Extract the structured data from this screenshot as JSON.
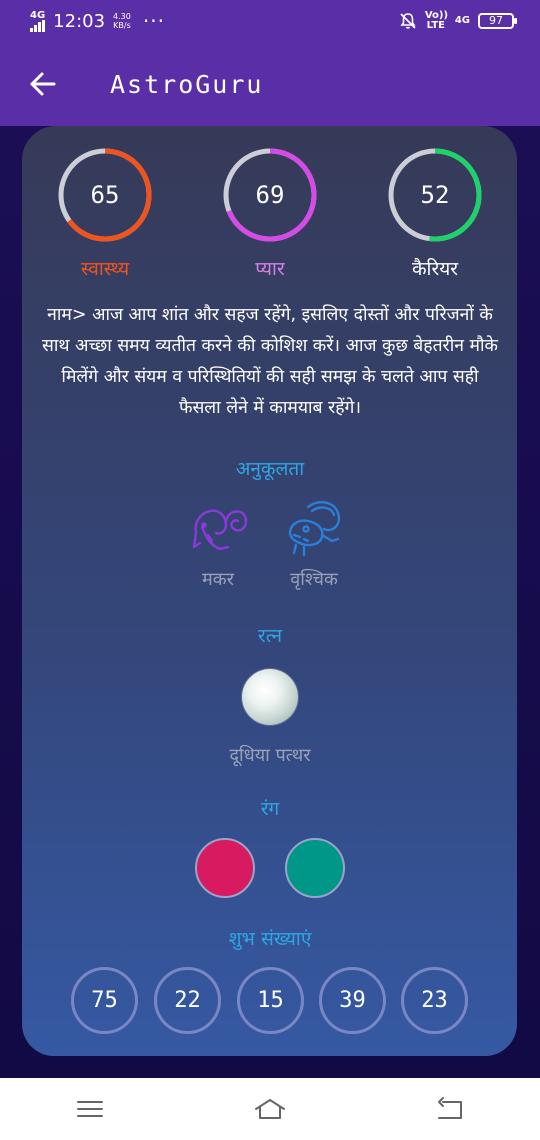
{
  "status_bar": {
    "network": "4G",
    "time": "12:03",
    "speed_value": "4.30",
    "speed_unit": "KB/s",
    "dots": "···",
    "volte": "Vo)) LTE",
    "network_right": "4G",
    "battery": "97"
  },
  "app_bar": {
    "title": "AstroGuru"
  },
  "scores": [
    {
      "value": "65",
      "label": "स्वास्थ्य",
      "percent": 65,
      "color": "#f0531c",
      "label_color": "#f0531c"
    },
    {
      "value": "69",
      "label": "प्यार",
      "percent": 69,
      "color": "#d64ae8",
      "label_color": "#d77fe8"
    },
    {
      "value": "52",
      "label": "कैरियर",
      "percent": 52,
      "color": "#1ed26a",
      "label_color": "#ffffff"
    }
  ],
  "horoscope_text": "नाम> आज आप शांत और सहज रहेंगे, इसलिए दोस्तों और परिजनों के साथ अच्छा समय व्यतीत करने की कोशिश करें। आज कुछ बेहतरीन मौके मिलेंगे और संयम व परिस्थितियों की सही समझ के चलते आप सही फैसला लेने में कामयाब रहेंगे।",
  "compatibility": {
    "title": "अनुकूलता",
    "signs": [
      {
        "name": "मकर",
        "icon": "capricorn-icon",
        "color": "#8a3ad8"
      },
      {
        "name": "वृश्चिक",
        "icon": "scorpio-icon",
        "color": "#2a7fd8"
      }
    ]
  },
  "gem": {
    "title": "रत्न",
    "name": "दूधिया पत्थर",
    "icon": "moonstone-icon"
  },
  "colors": {
    "title": "रंग",
    "swatches": [
      "#d81b60",
      "#009688"
    ]
  },
  "lucky_numbers": {
    "title": "शुभ संख्याएं",
    "values": [
      "75",
      "22",
      "15",
      "39",
      "23"
    ]
  },
  "nav": {
    "menu_icon": "menu-icon",
    "home_icon": "home-icon",
    "back_icon": "back-nav-icon"
  }
}
